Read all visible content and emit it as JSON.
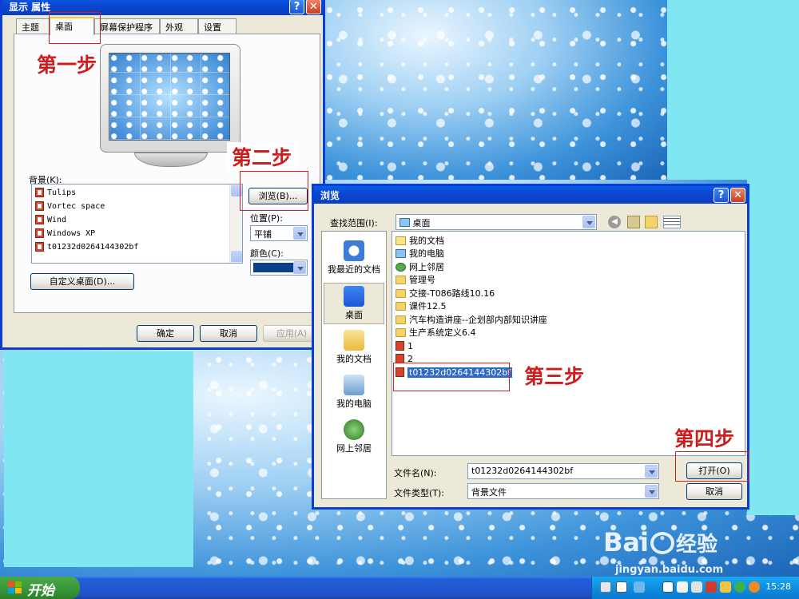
{
  "display_properties": {
    "title": "显示 属性",
    "tabs": [
      "主题",
      "桌面",
      "屏幕保护程序",
      "外观",
      "设置"
    ],
    "background_label": "背景(K):",
    "backgrounds": [
      "Tulips",
      "Vortec space",
      "Wind",
      "Windows XP",
      "t01232d0264144302bf"
    ],
    "browse_button": "浏览(B)...",
    "position_label": "位置(P):",
    "position_value": "平铺",
    "color_label": "颜色(C):",
    "color_value": "#0a3f8c",
    "customize_button": "自定义桌面(D)...",
    "ok_button": "确定",
    "cancel_button": "取消",
    "apply_button": "应用(A)"
  },
  "browse_dialog": {
    "title": "浏览",
    "look_in_label": "查找范围(I):",
    "look_in_value": "桌面",
    "places": [
      {
        "label": "我最近的文档",
        "icon": "recent-icon"
      },
      {
        "label": "桌面",
        "icon": "desktop-icon"
      },
      {
        "label": "我的文档",
        "icon": "my-documents-icon"
      },
      {
        "label": "我的电脑",
        "icon": "my-computer-icon"
      },
      {
        "label": "网上邻居",
        "icon": "network-icon"
      }
    ],
    "files": [
      {
        "name": "我的文档",
        "type": "doc"
      },
      {
        "name": "我的电脑",
        "type": "pc"
      },
      {
        "name": "网上邻居",
        "type": "net"
      },
      {
        "name": "管理号",
        "type": "folder"
      },
      {
        "name": "交接-T086路线10.16",
        "type": "folder"
      },
      {
        "name": "课件12.5",
        "type": "folder"
      },
      {
        "name": "汽车构造讲座--企划部内部知识讲座",
        "type": "folder"
      },
      {
        "name": "生产系统定义6.4",
        "type": "folder"
      },
      {
        "name": "1",
        "type": "img"
      },
      {
        "name": "2",
        "type": "img"
      },
      {
        "name": "t01232d0264144302bf",
        "type": "img"
      }
    ],
    "filename_label": "文件名(N):",
    "filename_value": "t01232d0264144302bf",
    "filetype_label": "文件类型(T):",
    "filetype_value": "背景文件",
    "open_button": "打开(O)",
    "cancel_button": "取消"
  },
  "steps": [
    "第一步",
    "第二步",
    "第三步",
    "第四步"
  ],
  "taskbar": {
    "start_label": "开始",
    "clock": "15:28"
  },
  "watermark": {
    "brand": "Bai",
    "brand_suffix": "经验",
    "url": "jingyan.baidu.com"
  },
  "colors": {
    "xp_blue": "#0a3fd6",
    "step_red": "#cf1d1d",
    "selection": "#316ac5",
    "desktop_cyan": "#7fe6f2"
  }
}
